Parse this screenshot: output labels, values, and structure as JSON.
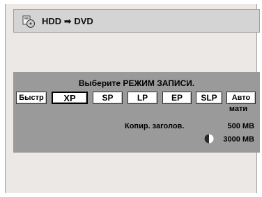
{
  "header": {
    "icon": "copy-hdd-to-dvd-icon",
    "source": "HDD",
    "arrow": "➡",
    "target": "DVD"
  },
  "dialog": {
    "prompt": "Выберите РЕЖИМ ЗАПИСИ.",
    "modes": [
      "Быстр",
      "XP",
      "SP",
      "LP",
      "EP",
      "SLP",
      "Авто"
    ],
    "auto_line2": "мати",
    "selected_mode": "XP"
  },
  "info": {
    "copy_label": "Копир. заголов.",
    "title_size": "500 MB",
    "disc_icon": "disc-free-space-icon",
    "disc_size": "3000 MB"
  },
  "colors": {
    "background": "#ebe8e6",
    "header": "#d4d4d4",
    "panel": "#9a9a9a",
    "button": "#ffffff"
  }
}
